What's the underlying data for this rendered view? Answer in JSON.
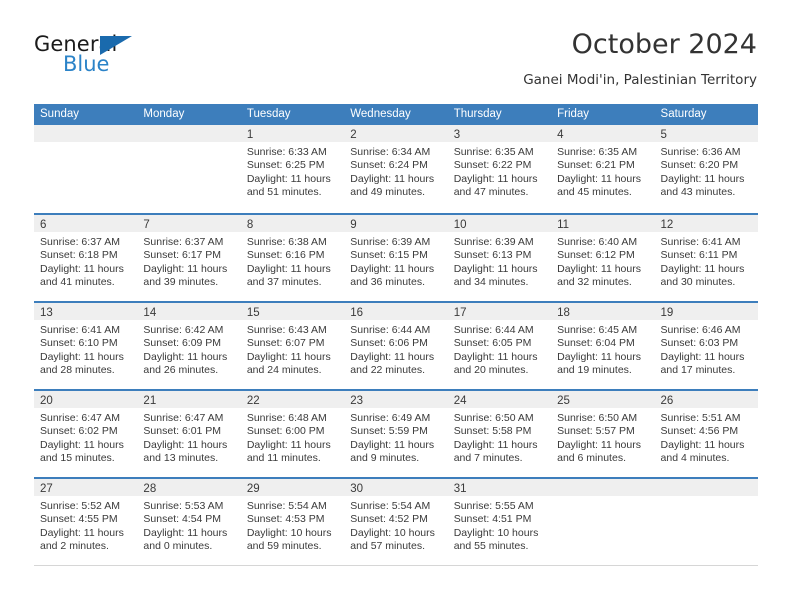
{
  "brand": {
    "name_part1": "General",
    "name_part2": "Blue",
    "triangle_color": "#1a6aad",
    "blue_color": "#2b83c8"
  },
  "header": {
    "title": "October 2024",
    "subtitle": "Ganei Modi'in, Palestinian Territory"
  },
  "theme": {
    "header_blue": "#3d7ebc",
    "day_band_gray": "#efefef",
    "text_color": "#3a3a3a"
  },
  "weekdays": [
    "Sunday",
    "Monday",
    "Tuesday",
    "Wednesday",
    "Thursday",
    "Friday",
    "Saturday"
  ],
  "weeks": [
    [
      {
        "day": "",
        "sunrise": "",
        "sunset": "",
        "daylight_line1": "",
        "daylight_line2": ""
      },
      {
        "day": "",
        "sunrise": "",
        "sunset": "",
        "daylight_line1": "",
        "daylight_line2": ""
      },
      {
        "day": "1",
        "sunrise": "Sunrise: 6:33 AM",
        "sunset": "Sunset: 6:25 PM",
        "daylight_line1": "Daylight: 11 hours",
        "daylight_line2": "and 51 minutes."
      },
      {
        "day": "2",
        "sunrise": "Sunrise: 6:34 AM",
        "sunset": "Sunset: 6:24 PM",
        "daylight_line1": "Daylight: 11 hours",
        "daylight_line2": "and 49 minutes."
      },
      {
        "day": "3",
        "sunrise": "Sunrise: 6:35 AM",
        "sunset": "Sunset: 6:22 PM",
        "daylight_line1": "Daylight: 11 hours",
        "daylight_line2": "and 47 minutes."
      },
      {
        "day": "4",
        "sunrise": "Sunrise: 6:35 AM",
        "sunset": "Sunset: 6:21 PM",
        "daylight_line1": "Daylight: 11 hours",
        "daylight_line2": "and 45 minutes."
      },
      {
        "day": "5",
        "sunrise": "Sunrise: 6:36 AM",
        "sunset": "Sunset: 6:20 PM",
        "daylight_line1": "Daylight: 11 hours",
        "daylight_line2": "and 43 minutes."
      }
    ],
    [
      {
        "day": "6",
        "sunrise": "Sunrise: 6:37 AM",
        "sunset": "Sunset: 6:18 PM",
        "daylight_line1": "Daylight: 11 hours",
        "daylight_line2": "and 41 minutes."
      },
      {
        "day": "7",
        "sunrise": "Sunrise: 6:37 AM",
        "sunset": "Sunset: 6:17 PM",
        "daylight_line1": "Daylight: 11 hours",
        "daylight_line2": "and 39 minutes."
      },
      {
        "day": "8",
        "sunrise": "Sunrise: 6:38 AM",
        "sunset": "Sunset: 6:16 PM",
        "daylight_line1": "Daylight: 11 hours",
        "daylight_line2": "and 37 minutes."
      },
      {
        "day": "9",
        "sunrise": "Sunrise: 6:39 AM",
        "sunset": "Sunset: 6:15 PM",
        "daylight_line1": "Daylight: 11 hours",
        "daylight_line2": "and 36 minutes."
      },
      {
        "day": "10",
        "sunrise": "Sunrise: 6:39 AM",
        "sunset": "Sunset: 6:13 PM",
        "daylight_line1": "Daylight: 11 hours",
        "daylight_line2": "and 34 minutes."
      },
      {
        "day": "11",
        "sunrise": "Sunrise: 6:40 AM",
        "sunset": "Sunset: 6:12 PM",
        "daylight_line1": "Daylight: 11 hours",
        "daylight_line2": "and 32 minutes."
      },
      {
        "day": "12",
        "sunrise": "Sunrise: 6:41 AM",
        "sunset": "Sunset: 6:11 PM",
        "daylight_line1": "Daylight: 11 hours",
        "daylight_line2": "and 30 minutes."
      }
    ],
    [
      {
        "day": "13",
        "sunrise": "Sunrise: 6:41 AM",
        "sunset": "Sunset: 6:10 PM",
        "daylight_line1": "Daylight: 11 hours",
        "daylight_line2": "and 28 minutes."
      },
      {
        "day": "14",
        "sunrise": "Sunrise: 6:42 AM",
        "sunset": "Sunset: 6:09 PM",
        "daylight_line1": "Daylight: 11 hours",
        "daylight_line2": "and 26 minutes."
      },
      {
        "day": "15",
        "sunrise": "Sunrise: 6:43 AM",
        "sunset": "Sunset: 6:07 PM",
        "daylight_line1": "Daylight: 11 hours",
        "daylight_line2": "and 24 minutes."
      },
      {
        "day": "16",
        "sunrise": "Sunrise: 6:44 AM",
        "sunset": "Sunset: 6:06 PM",
        "daylight_line1": "Daylight: 11 hours",
        "daylight_line2": "and 22 minutes."
      },
      {
        "day": "17",
        "sunrise": "Sunrise: 6:44 AM",
        "sunset": "Sunset: 6:05 PM",
        "daylight_line1": "Daylight: 11 hours",
        "daylight_line2": "and 20 minutes."
      },
      {
        "day": "18",
        "sunrise": "Sunrise: 6:45 AM",
        "sunset": "Sunset: 6:04 PM",
        "daylight_line1": "Daylight: 11 hours",
        "daylight_line2": "and 19 minutes."
      },
      {
        "day": "19",
        "sunrise": "Sunrise: 6:46 AM",
        "sunset": "Sunset: 6:03 PM",
        "daylight_line1": "Daylight: 11 hours",
        "daylight_line2": "and 17 minutes."
      }
    ],
    [
      {
        "day": "20",
        "sunrise": "Sunrise: 6:47 AM",
        "sunset": "Sunset: 6:02 PM",
        "daylight_line1": "Daylight: 11 hours",
        "daylight_line2": "and 15 minutes."
      },
      {
        "day": "21",
        "sunrise": "Sunrise: 6:47 AM",
        "sunset": "Sunset: 6:01 PM",
        "daylight_line1": "Daylight: 11 hours",
        "daylight_line2": "and 13 minutes."
      },
      {
        "day": "22",
        "sunrise": "Sunrise: 6:48 AM",
        "sunset": "Sunset: 6:00 PM",
        "daylight_line1": "Daylight: 11 hours",
        "daylight_line2": "and 11 minutes."
      },
      {
        "day": "23",
        "sunrise": "Sunrise: 6:49 AM",
        "sunset": "Sunset: 5:59 PM",
        "daylight_line1": "Daylight: 11 hours",
        "daylight_line2": "and 9 minutes."
      },
      {
        "day": "24",
        "sunrise": "Sunrise: 6:50 AM",
        "sunset": "Sunset: 5:58 PM",
        "daylight_line1": "Daylight: 11 hours",
        "daylight_line2": "and 7 minutes."
      },
      {
        "day": "25",
        "sunrise": "Sunrise: 6:50 AM",
        "sunset": "Sunset: 5:57 PM",
        "daylight_line1": "Daylight: 11 hours",
        "daylight_line2": "and 6 minutes."
      },
      {
        "day": "26",
        "sunrise": "Sunrise: 5:51 AM",
        "sunset": "Sunset: 4:56 PM",
        "daylight_line1": "Daylight: 11 hours",
        "daylight_line2": "and 4 minutes."
      }
    ],
    [
      {
        "day": "27",
        "sunrise": "Sunrise: 5:52 AM",
        "sunset": "Sunset: 4:55 PM",
        "daylight_line1": "Daylight: 11 hours",
        "daylight_line2": "and 2 minutes."
      },
      {
        "day": "28",
        "sunrise": "Sunrise: 5:53 AM",
        "sunset": "Sunset: 4:54 PM",
        "daylight_line1": "Daylight: 11 hours",
        "daylight_line2": "and 0 minutes."
      },
      {
        "day": "29",
        "sunrise": "Sunrise: 5:54 AM",
        "sunset": "Sunset: 4:53 PM",
        "daylight_line1": "Daylight: 10 hours",
        "daylight_line2": "and 59 minutes."
      },
      {
        "day": "30",
        "sunrise": "Sunrise: 5:54 AM",
        "sunset": "Sunset: 4:52 PM",
        "daylight_line1": "Daylight: 10 hours",
        "daylight_line2": "and 57 minutes."
      },
      {
        "day": "31",
        "sunrise": "Sunrise: 5:55 AM",
        "sunset": "Sunset: 4:51 PM",
        "daylight_line1": "Daylight: 10 hours",
        "daylight_line2": "and 55 minutes."
      },
      {
        "day": "",
        "sunrise": "",
        "sunset": "",
        "daylight_line1": "",
        "daylight_line2": ""
      },
      {
        "day": "",
        "sunrise": "",
        "sunset": "",
        "daylight_line1": "",
        "daylight_line2": ""
      }
    ]
  ]
}
